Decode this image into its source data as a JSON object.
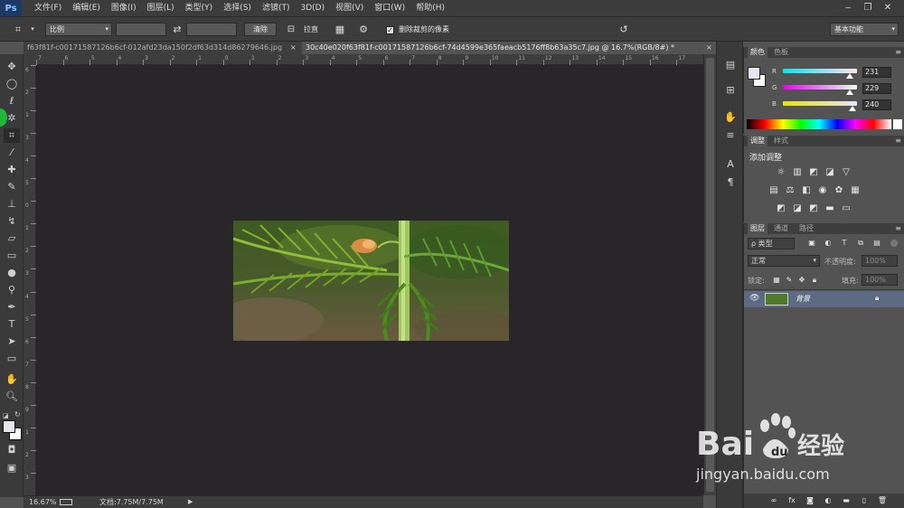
{
  "app": {
    "logo": "Ps"
  },
  "menu": [
    "文件(F)",
    "编辑(E)",
    "图像(I)",
    "图层(L)",
    "类型(Y)",
    "选择(S)",
    "滤镜(T)",
    "3D(D)",
    "视图(V)",
    "窗口(W)",
    "帮助(H)"
  ],
  "window_controls": [
    "‒",
    "❐",
    "✕"
  ],
  "options": {
    "ratio_select": "比例",
    "clear_button": "清除",
    "straighten_label": "拉直",
    "delete_cropped_label": "删除裁剪的像素",
    "delete_cropped_checked": true,
    "workspace_select": "基本功能"
  },
  "tabs": [
    {
      "label": "f63f81f-c00171587126b6cf-012afd23da150f2df63d314d86279646.jpg",
      "active": false
    },
    {
      "label": "30c40e020f63f81f-c00171587126b6cf-74d4599e365faeacb5176ff8b63a35c7.jpg @ 16.7%(RGB/8#) *",
      "active": true
    }
  ],
  "ruler_top_ticks": [
    "7",
    "6",
    "5",
    "4",
    "3",
    "2",
    "1",
    "0",
    "1",
    "2",
    "3",
    "4",
    "5",
    "6",
    "7",
    "8",
    "9",
    "10",
    "11",
    "12",
    "13",
    "14",
    "15",
    "16",
    "17"
  ],
  "ruler_left_ticks": [
    "6",
    "2",
    "1",
    "3",
    "4",
    "5",
    "0",
    "1",
    "2",
    "3",
    "4",
    "5",
    "6",
    "7",
    "8",
    "9",
    "1",
    "2",
    "3"
  ],
  "status": {
    "zoom": "16.67%",
    "doc_info": "文档:7.75M/7.75M"
  },
  "color_panel": {
    "tabs": [
      "颜色",
      "色板"
    ],
    "r": {
      "label": "R",
      "value": "231",
      "fraction": 0.906
    },
    "g": {
      "label": "G",
      "value": "229",
      "fraction": 0.898
    },
    "b": {
      "label": "B",
      "value": "240",
      "fraction": 0.941
    },
    "foreground": "#e7e5f0"
  },
  "adjust_panel": {
    "tabs": [
      "调整",
      "样式"
    ],
    "title": "添加调整"
  },
  "layers_panel": {
    "tabs": [
      "图层",
      "通道",
      "路径"
    ],
    "filter_label": "ρ 类型",
    "blend_mode": "正常",
    "opacity_label": "不透明度:",
    "opacity_value": "100%",
    "lock_label": "锁定:",
    "fill_label": "填充:",
    "fill_value": "100%",
    "layer_name": "背景"
  },
  "watermark": {
    "brand_left": "Bai",
    "brand_right": "经验",
    "url": "jingyan.baidu.com"
  }
}
